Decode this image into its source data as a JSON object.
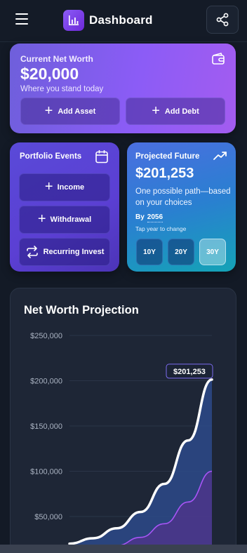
{
  "header": {
    "title": "Dashboard",
    "menu_icon": "hamburger-menu-icon",
    "logo_icon": "bar-chart-icon",
    "share_icon": "share-icon"
  },
  "net_worth": {
    "label": "Current Net Worth",
    "value": "$20,000",
    "subtitle": "Where you stand today",
    "icon": "wallet-icon",
    "add_asset": "Add Asset",
    "add_debt": "Add Debt"
  },
  "events": {
    "title": "Portfolio Events",
    "icon": "calendar-icon",
    "income": "Income",
    "withdrawal": "Withdrawal",
    "recurring": "Recurring Invest"
  },
  "future": {
    "title": "Projected Future",
    "icon": "trending-up-icon",
    "value": "$201,253",
    "description": "One possible path—based on your choices",
    "by_label": "By",
    "year": "2056",
    "hint": "Tap year to change",
    "horizons": [
      "10Y",
      "20Y",
      "30Y"
    ],
    "active_horizon": "30Y"
  },
  "chart": {
    "title": "Net Worth Projection",
    "callout": "$201,253"
  },
  "chart_data": {
    "type": "area",
    "title": "Net Worth Projection",
    "y_ticks": [
      "$250,000",
      "$200,000",
      "$150,000",
      "$100,000",
      "$50,000"
    ],
    "ylim": [
      0,
      250000
    ],
    "x": [
      0,
      5,
      10,
      15,
      20,
      25,
      30
    ],
    "series": [
      {
        "values": [
          20000,
          26000,
          37000,
          55000,
          86000,
          134000,
          201253
        ]
      },
      {
        "values": [
          10000,
          13000,
          18000,
          27000,
          42000,
          66000,
          100000
        ]
      }
    ],
    "colors": {
      "projection": "#ffffff",
      "contributions": "#a855f7",
      "area": "#2d4a8a"
    },
    "grid": true
  }
}
